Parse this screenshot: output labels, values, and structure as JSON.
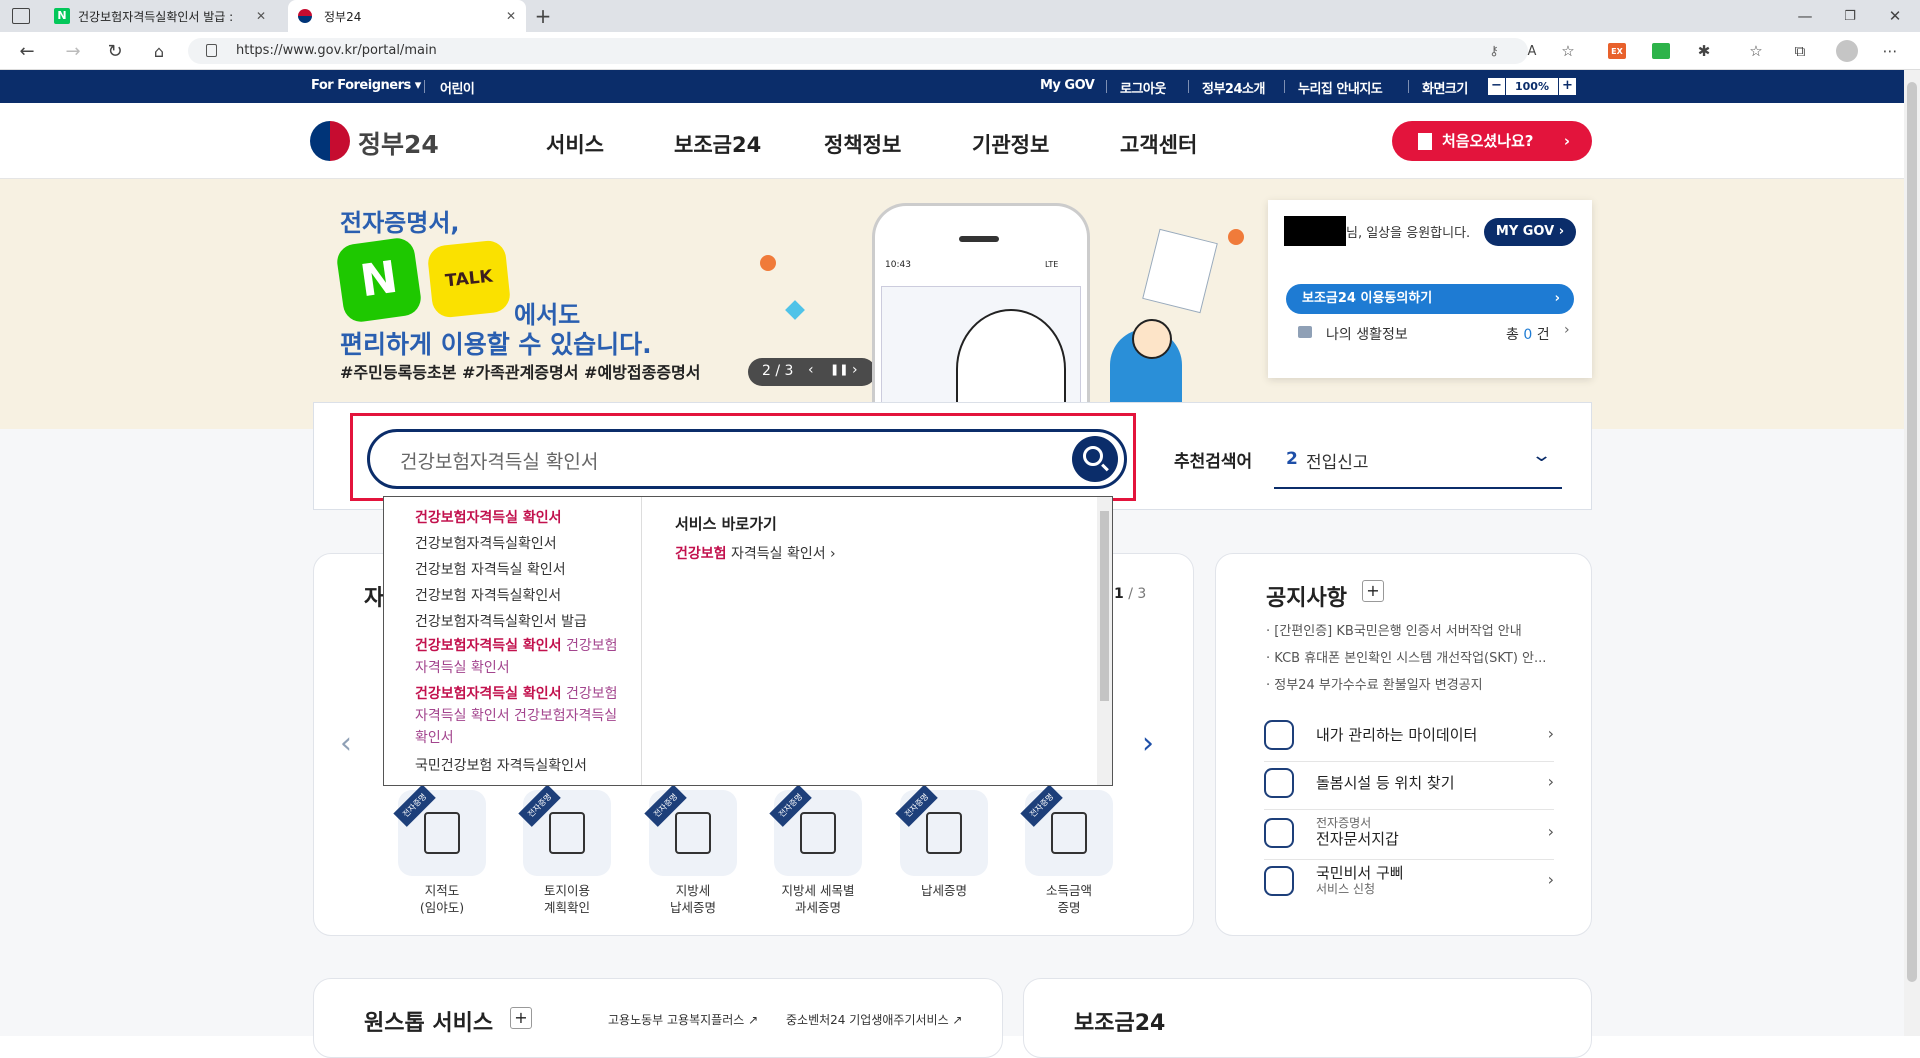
{
  "browser": {
    "tabs": [
      {
        "title": "건강보험자격득실확인서 발급 : ",
        "favicon": "naver-icon"
      },
      {
        "title": "정부24",
        "favicon": "gov24-icon"
      }
    ],
    "url": "https://www.gov.kr/portal/main"
  },
  "utility": {
    "foreigners": "For Foreigners ▾",
    "kids": "어린이",
    "links": [
      "My GOV",
      "로그아웃",
      "정부24소개",
      "누리집 안내지도",
      "화면크기"
    ],
    "zoom": "100%"
  },
  "gnb": {
    "logo": "정부24",
    "menu": [
      "서비스",
      "보조금24",
      "정책정보",
      "기관정보",
      "고객센터"
    ],
    "first_visit": "처음오셨나요?"
  },
  "hero": {
    "line1": "전자증명서,",
    "n_label": "N",
    "talk_label": "TALK",
    "line2": "에서도",
    "line3": "편리하게 이용할 수 있습니다.",
    "tags": "#주민등록등초본  #가족관계증명서  #예방접종증명서",
    "pager": "2 / 3",
    "phone_time": "10:43",
    "phone_status": "LTE"
  },
  "mygov": {
    "greeting": "님, 일상을 응원합니다.",
    "my_gov_button": "MY GOV ›",
    "consent": "보조금24 이용동의하기",
    "life_info": "나의 생활정보",
    "life_count_prefix": "총",
    "life_count": "0",
    "life_count_suffix": "건"
  },
  "search": {
    "query": "건강보험자격득실 확인서",
    "recommend_label": "추천검색어",
    "recommend_rank": "2",
    "recommend_term": "전입신고"
  },
  "autocomplete": {
    "suggestions": [
      {
        "parts": [
          {
            "t": "건강보험자격득실 확인서",
            "c": "hl"
          }
        ]
      },
      {
        "parts": [
          {
            "t": "건강보험자격득실확인서",
            "c": ""
          }
        ]
      },
      {
        "parts": [
          {
            "t": "건강보험 자격득실 확인서",
            "c": ""
          }
        ]
      },
      {
        "parts": [
          {
            "t": "건강보험 자격득실확인서",
            "c": ""
          }
        ]
      },
      {
        "parts": [
          {
            "t": "건강보험자격득실확인서 발급",
            "c": ""
          }
        ]
      },
      {
        "parts": [
          {
            "t": "건강보험자격득실 확인서",
            "c": "hl"
          },
          {
            "t": " 건강보험자격득실 확인서",
            "c": "hl2"
          }
        ]
      },
      {
        "parts": [
          {
            "t": "건강보험자격득실 확인서",
            "c": "hl"
          },
          {
            "t": " 건강보험자격득실 확인서 건강보험자격득실 확인서",
            "c": "hl2"
          }
        ]
      },
      {
        "parts": [
          {
            "t": "국민건강보험 자격득실확인서",
            "c": ""
          }
        ]
      }
    ],
    "shortcut_title": "서비스 바로가기",
    "shortcut_hl": "건강보험",
    "shortcut_rest": " 자격득실 확인서",
    "shortcut_arrow": "›"
  },
  "services": {
    "title_fragment": "자",
    "pager_current": "1",
    "pager_total": " / 3",
    "badge": "전자증명",
    "items": [
      {
        "label": "지적도\n(임야도)",
        "icon": "map-icon"
      },
      {
        "label": "토지이용\n계획확인",
        "icon": "land-pin-icon"
      },
      {
        "label": "지방세\n납세증명",
        "icon": "document-icon"
      },
      {
        "label": "지방세 세목별\n과세증명",
        "icon": "chart-board-icon"
      },
      {
        "label": "납세증명",
        "icon": "coins-doc-icon"
      },
      {
        "label": "소득금액\n증명",
        "icon": "database-doc-icon"
      }
    ]
  },
  "notice": {
    "title": "공지사항",
    "items": [
      "[간편인증] KB국민은행 인증서 서버작업 안내",
      "KCB 휴대폰 본인확인 시스템 개선작업(SKT) 안...",
      "정부24 부가수수료 환불일자 변경공지"
    ],
    "links": [
      {
        "label": "내가 관리하는 마이데이터",
        "sub": "",
        "icon": "cloud-data-icon"
      },
      {
        "label": "돌봄시설 등 위치 찾기",
        "sub": "",
        "icon": "location-pin-icon"
      },
      {
        "label": "전자문서지갑",
        "sub": "전자증명서",
        "icon": "wallet-phone-icon"
      },
      {
        "label": "국민비서 구삐",
        "sub": "서비스 신청",
        "icon": "gubby-icon"
      }
    ]
  },
  "bottom": {
    "onestop": "원스톱 서비스",
    "onestop_links": [
      "고용노동부 고용복지플러스 ↗",
      "중소벤처24 기업생애주기서비스 ↗"
    ],
    "subsidy": "보조금24"
  },
  "colors": {
    "navy": "#0b2d6a",
    "red": "#e3143c",
    "blue": "#1e7bd3",
    "highlight": "#c2114d"
  }
}
